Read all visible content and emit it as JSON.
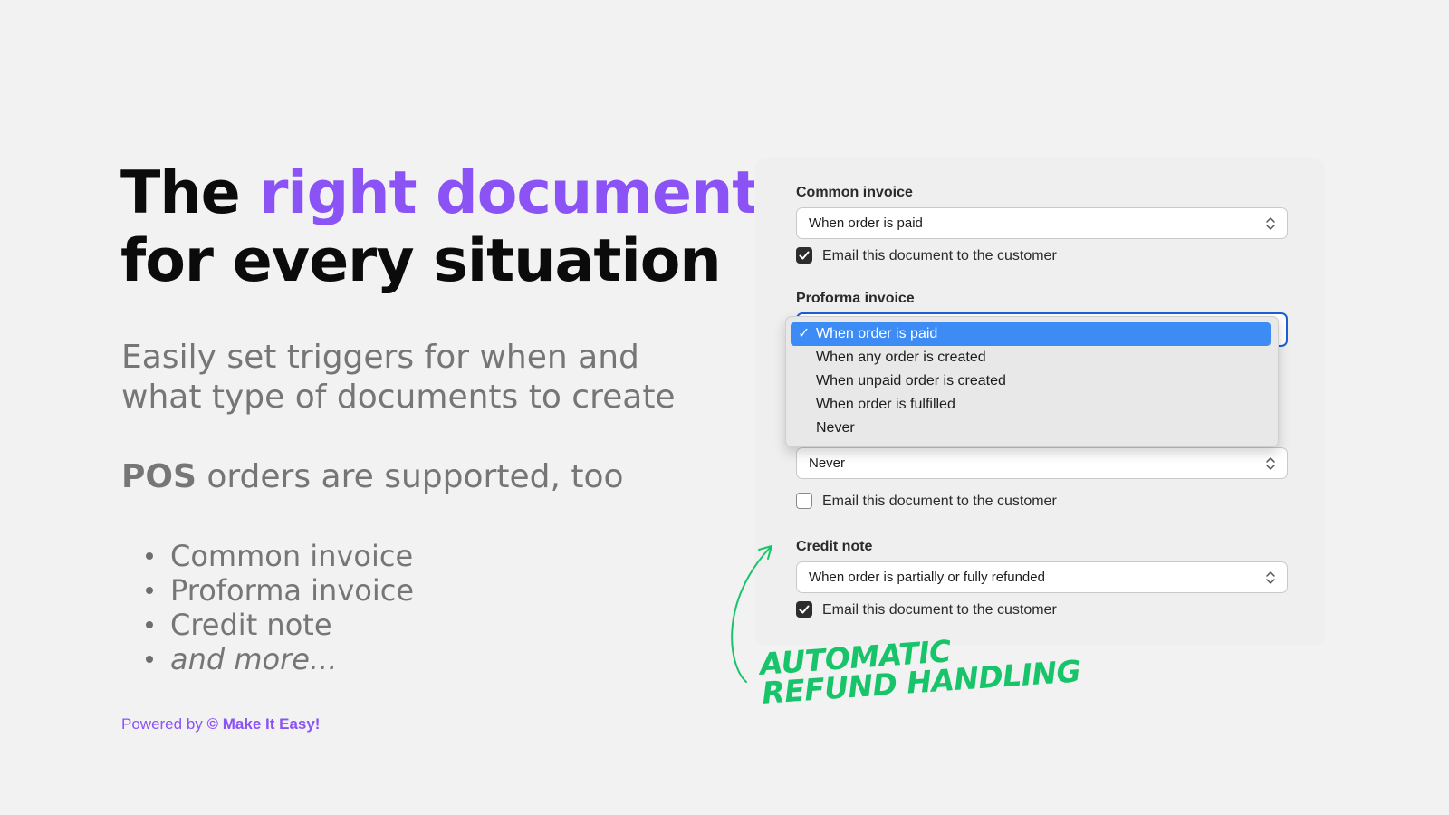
{
  "headline": {
    "part1": "The ",
    "accent": "right document",
    "part2": "for every situation"
  },
  "subtitle": "Easily set triggers for when and what type of documents to create",
  "pos": {
    "bold": "POS",
    "rest": " orders are supported, too"
  },
  "bullets": [
    "Common invoice",
    "Proforma invoice",
    "Credit note",
    "and more..."
  ],
  "powered": {
    "prefix": "Powered by ",
    "brand": "© Make It Easy!"
  },
  "colors": {
    "accent": "#8b52f6",
    "callout": "#17c46a",
    "selected": "#3d8bf5"
  },
  "settings": {
    "common": {
      "label": "Common invoice",
      "value": "When order is paid",
      "email_label": "Email this document to the customer",
      "email_checked": true
    },
    "proforma": {
      "label": "Proforma invoice"
    },
    "third": {
      "value": "Never",
      "email_label": "Email this document to the customer",
      "email_checked": false
    },
    "credit": {
      "label": "Credit note",
      "value": "When order is partially or fully refunded",
      "email_label": "Email this document to the customer",
      "email_checked": true
    }
  },
  "dropdown": {
    "options": [
      "When order is paid",
      "When any order is created",
      "When unpaid order is created",
      "When order is fulfilled",
      "Never"
    ],
    "selected_index": 0,
    "check_glyph": "✓"
  },
  "callout": {
    "line1": "Automatic",
    "line2": "Refund handling"
  }
}
